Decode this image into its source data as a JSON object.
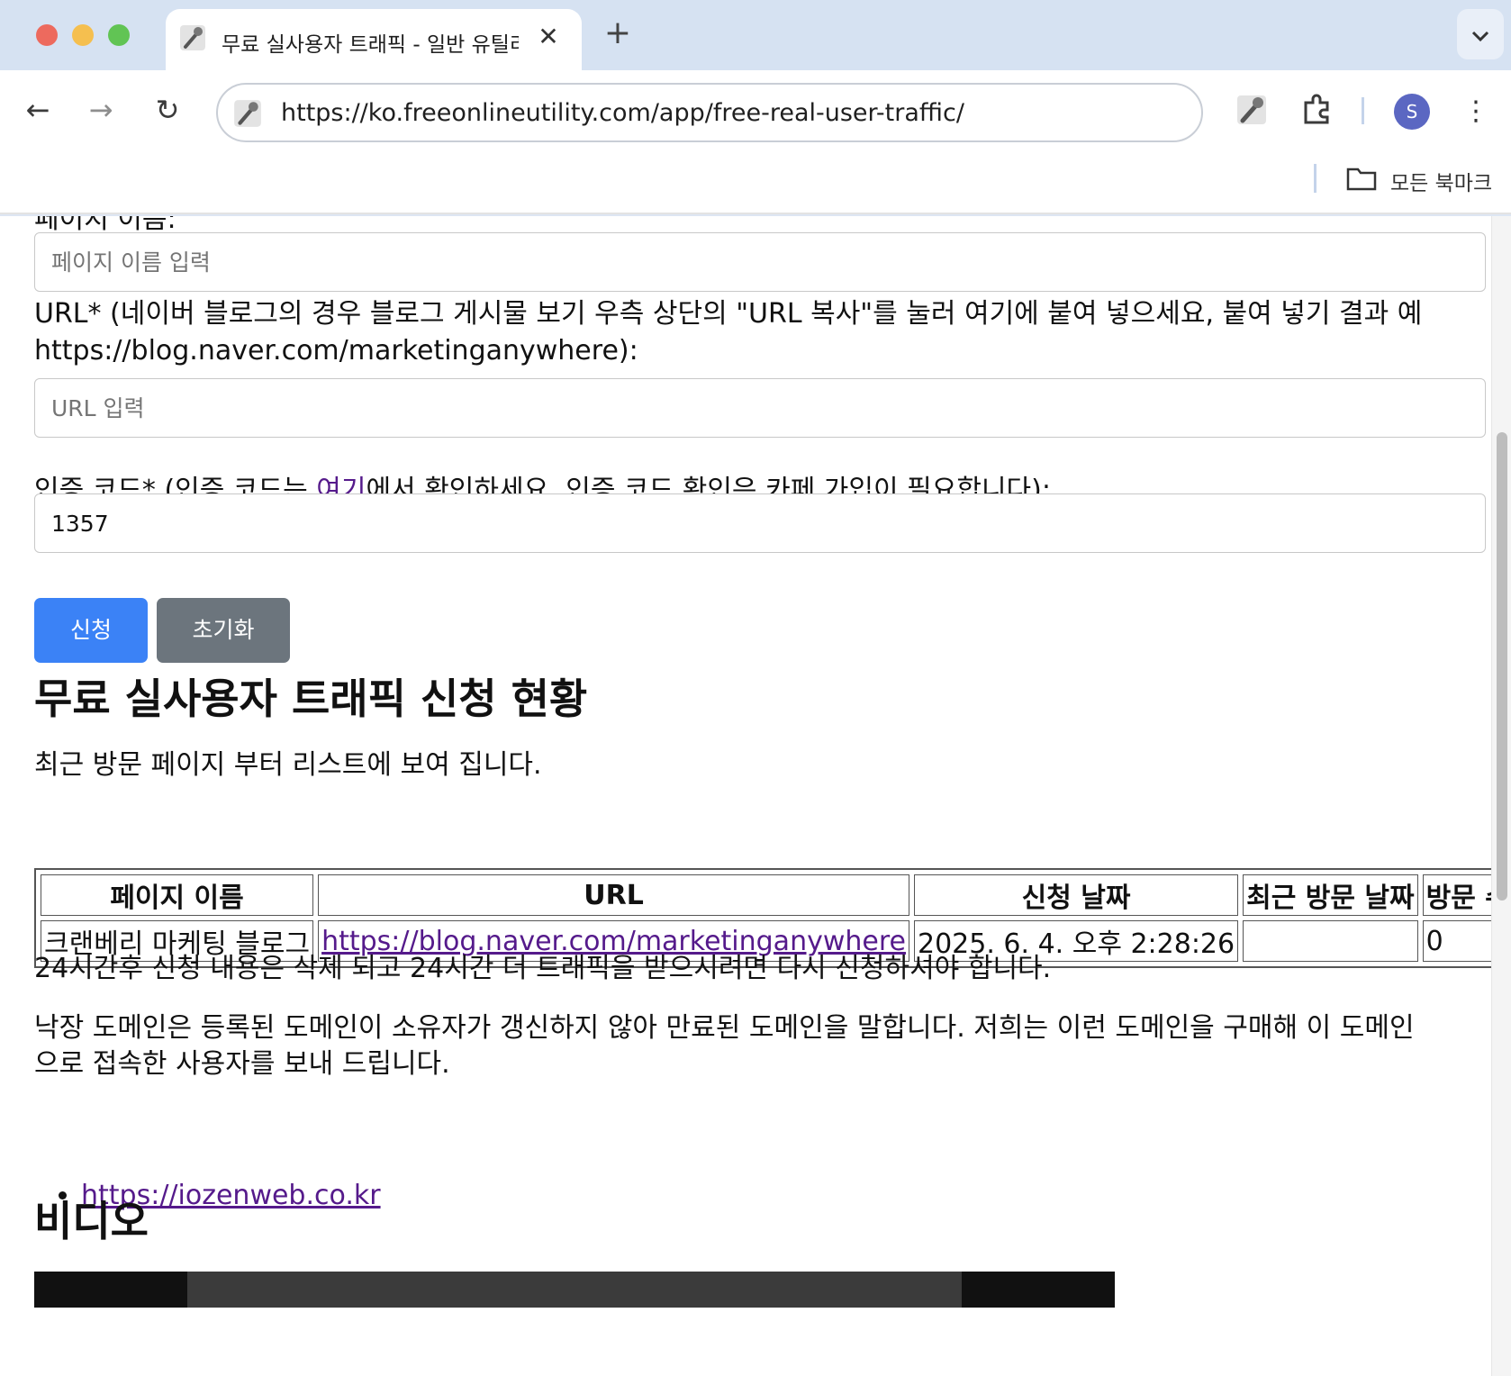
{
  "browser": {
    "tab_title": "무료 실사용자 트래픽 - 일반 유틸리",
    "tab_close": "✕",
    "new_tab": "+",
    "tab_menu": "⌄",
    "back": "←",
    "forward": "→",
    "reload": "↻",
    "url": "https://ko.freeonlineutility.com/app/free-real-user-traffic/",
    "avatar_letter": "S",
    "menu": "⋮",
    "bookmarks_label": "모든 북마크"
  },
  "form": {
    "page_name_label": "페이지 이름:",
    "page_name_placeholder": "페이지 이름 입력",
    "url_label": "URL* (네이버 블로그의 경우 블로그 게시물 보기 우측 상단의 \"URL 복사\"를 눌러 여기에 붙여 넣으세요, 붙여 넣기 결과 예 https://blog.naver.com/marketinganywhere):",
    "url_placeholder": "URL 입력",
    "auth_label_before": "인증 코드* (인증 코드는 ",
    "auth_label_link": "여기",
    "auth_label_after": "에서 확인하세요. 인증 코드 확인은 카페 가입이 필요합니다):",
    "auth_value": "1357",
    "submit_label": "신청",
    "reset_label": "초기화"
  },
  "status": {
    "heading": "무료 실사용자 트래픽 신청 현황",
    "description": "최근 방문 페이지 부터 리스트에 보여 집니다.",
    "columns": [
      "페이지 이름",
      "URL",
      "신청 날짜",
      "최근 방문 날짜",
      "방문 수"
    ],
    "rows": [
      {
        "page_name": "크랜베리 마케팅 블로그",
        "url": "https://blog.naver.com/marketinganywhere",
        "applied": "2025. 6. 4. 오후 2:28:26",
        "last_visit": "",
        "visits": "0"
      }
    ]
  },
  "notes": {
    "expiry": "24시간후 신청 내용은 삭제 되고 24시간 더 트래픽을 받으시려면 다시 신청하셔야 합니다.",
    "parked": "낙장 도메인은 등록된 도메인이 소유자가 갱신하지 않아 만료된 도메인을 말합니다. 저희는 이런 도메인을 구매해 이 도메인으로 접속한 사용자를 보내 드립니다.",
    "links": [
      "https://iozenweb.co.kr"
    ]
  },
  "video": {
    "heading": "비디오"
  },
  "colors": {
    "submit": "#3b82f6",
    "reset": "#6c757d",
    "link": "#551a8b",
    "avatar": "#5b67c2"
  }
}
